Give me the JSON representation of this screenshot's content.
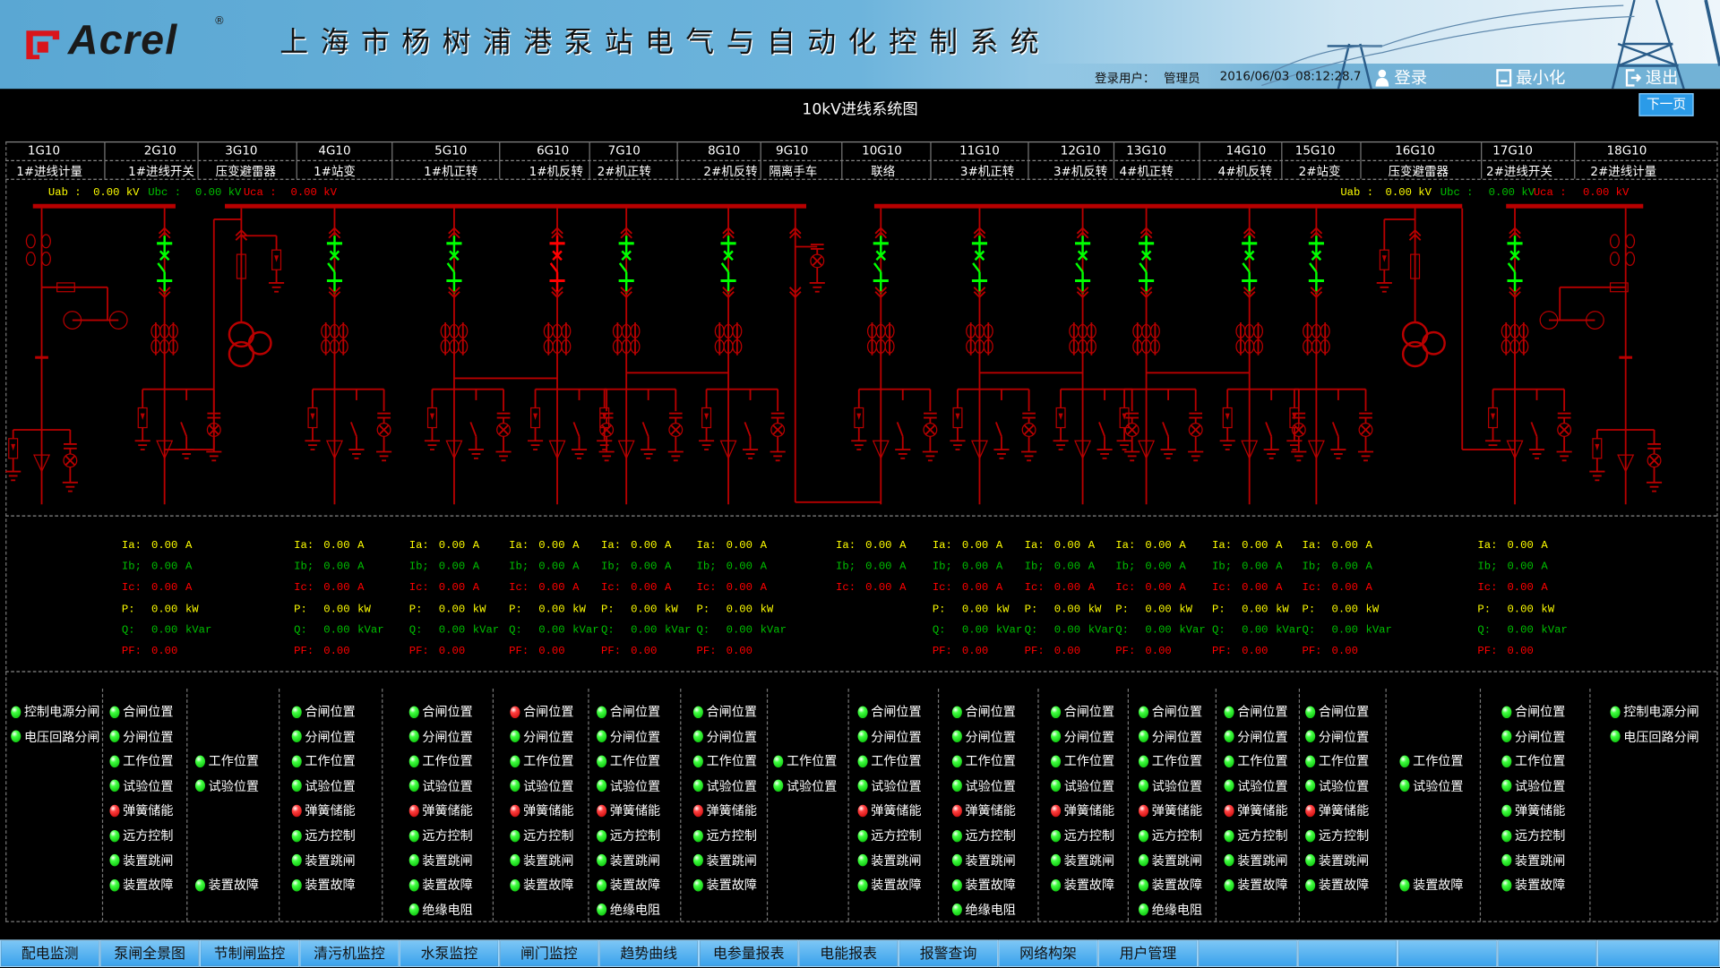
{
  "header": {
    "logo": "Acrel",
    "title": "上海市杨树浦港泵站电气与自动化控制系统",
    "login_user_label": "登录用户：",
    "login_user": "管理员",
    "date": "2016/06/03",
    "time": "08:12:28.7",
    "login_button": "登录",
    "minimize_button": "最小化",
    "exit_button": "退出"
  },
  "page": {
    "title": "10kV进线系统图",
    "next_page": "下一页"
  },
  "colors": {
    "closed": "#ff0000",
    "open": "#00ff00",
    "bus": "#b80000",
    "phase_a": "#ffff00",
    "phase_b": "#00c000",
    "phase_c": "#ff0000"
  },
  "cabinets": [
    {
      "id": "1G10",
      "name": "1#进线计量"
    },
    {
      "id": "2G10",
      "name": "1#进线开关"
    },
    {
      "id": "3G10",
      "name": "压变避雷器"
    },
    {
      "id": "4G10",
      "name": "1#站变"
    },
    {
      "id": "5G10",
      "name": "1#机正转"
    },
    {
      "id": "6G10",
      "name": "1#机反转"
    },
    {
      "id": "7G10",
      "name": "2#机正转"
    },
    {
      "id": "8G10",
      "name": "2#机反转"
    },
    {
      "id": "9G10",
      "name": "隔离手车"
    },
    {
      "id": "10G10",
      "name": "联络"
    },
    {
      "id": "11G10",
      "name": "3#机正转"
    },
    {
      "id": "12G10",
      "name": "3#机反转"
    },
    {
      "id": "13G10",
      "name": "4#机正转"
    },
    {
      "id": "14G10",
      "name": "4#机反转"
    },
    {
      "id": "15G10",
      "name": "2#站变"
    },
    {
      "id": "16G10",
      "name": "压变避雷器"
    },
    {
      "id": "17G10",
      "name": "2#进线开关"
    },
    {
      "id": "18G10",
      "name": "2#进线计量"
    }
  ],
  "voltage": {
    "left": {
      "uab_label": "Uab :",
      "uab": "0.00 kV",
      "ubc_label": "Ubc :",
      "ubc": "0.00 kV",
      "uca_label": "Uca :",
      "uca": "0.00 kV"
    },
    "right": {
      "uab_label": "Uab :",
      "uab": "0.00 kV",
      "ubc_label": "Ubc :",
      "ubc": "0.00 kV",
      "uca_label": "Uca :",
      "uca": "0.00 kV"
    }
  },
  "breakers": [
    {
      "cabinet": "2G10",
      "state": "open"
    },
    {
      "cabinet": "4G10",
      "state": "open"
    },
    {
      "cabinet": "5G10",
      "state": "open"
    },
    {
      "cabinet": "6G10",
      "state": "closed"
    },
    {
      "cabinet": "7G10",
      "state": "open"
    },
    {
      "cabinet": "8G10",
      "state": "open"
    },
    {
      "cabinet": "10G10",
      "state": "open"
    },
    {
      "cabinet": "11G10",
      "state": "open"
    },
    {
      "cabinet": "12G10",
      "state": "open"
    },
    {
      "cabinet": "13G10",
      "state": "open"
    },
    {
      "cabinet": "14G10",
      "state": "open"
    },
    {
      "cabinet": "15G10",
      "state": "open"
    },
    {
      "cabinet": "17G10",
      "state": "open"
    }
  ],
  "measurements": [
    {
      "cabinet": "2G10",
      "rows": [
        [
          "Ia:",
          "0.00",
          "A"
        ],
        [
          "Ib;",
          "0.00",
          "A"
        ],
        [
          "Ic:",
          "0.00",
          "A"
        ],
        [
          "P:",
          "0.00",
          "kW"
        ],
        [
          "Q:",
          "0.00",
          "kVar"
        ],
        [
          "PF:",
          "0.00",
          ""
        ]
      ]
    },
    {
      "cabinet": "4G10",
      "rows": [
        [
          "Ia:",
          "0.00",
          "A"
        ],
        [
          "Ib;",
          "0.00",
          "A"
        ],
        [
          "Ic:",
          "0.00",
          "A"
        ],
        [
          "P:",
          "0.00",
          "kW"
        ],
        [
          "Q:",
          "0.00",
          "kVar"
        ],
        [
          "PF:",
          "0.00",
          ""
        ]
      ]
    },
    {
      "cabinet": "5G10",
      "rows": [
        [
          "Ia:",
          "0.00",
          "A"
        ],
        [
          "Ib;",
          "0.00",
          "A"
        ],
        [
          "Ic:",
          "0.00",
          "A"
        ],
        [
          "P:",
          "0.00",
          "kW"
        ],
        [
          "Q:",
          "0.00",
          "kVar"
        ],
        [
          "PF:",
          "0.00",
          ""
        ]
      ]
    },
    {
      "cabinet": "6G10",
      "rows": [
        [
          "Ia:",
          "0.00",
          "A"
        ],
        [
          "Ib;",
          "0.00",
          "A"
        ],
        [
          "Ic:",
          "0.00",
          "A"
        ],
        [
          "P:",
          "0.00",
          "kW"
        ],
        [
          "Q:",
          "0.00",
          "kVar"
        ],
        [
          "PF:",
          "0.00",
          ""
        ]
      ]
    },
    {
      "cabinet": "7G10",
      "rows": [
        [
          "Ia:",
          "0.00",
          "A"
        ],
        [
          "Ib;",
          "0.00",
          "A"
        ],
        [
          "Ic:",
          "0.00",
          "A"
        ],
        [
          "P:",
          "0.00",
          "kW"
        ],
        [
          "Q:",
          "0.00",
          "kVar"
        ],
        [
          "PF:",
          "0.00",
          ""
        ]
      ]
    },
    {
      "cabinet": "8G10",
      "rows": [
        [
          "Ia:",
          "0.00",
          "A"
        ],
        [
          "Ib;",
          "0.00",
          "A"
        ],
        [
          "Ic:",
          "0.00",
          "A"
        ],
        [
          "P:",
          "0.00",
          "kW"
        ],
        [
          "Q:",
          "0.00",
          "kVar"
        ],
        [
          "PF:",
          "0.00",
          ""
        ]
      ]
    },
    {
      "cabinet": "10G10",
      "rows": [
        [
          "Ia:",
          "0.00",
          "A"
        ],
        [
          "Ib;",
          "0.00",
          "A"
        ],
        [
          "Ic:",
          "0.00",
          "A"
        ]
      ]
    },
    {
      "cabinet": "11G10",
      "rows": [
        [
          "Ia:",
          "0.00",
          "A"
        ],
        [
          "Ib;",
          "0.00",
          "A"
        ],
        [
          "Ic:",
          "0.00",
          "A"
        ],
        [
          "P:",
          "0.00",
          "kW"
        ],
        [
          "Q:",
          "0.00",
          "kVar"
        ],
        [
          "PF:",
          "0.00",
          ""
        ]
      ]
    },
    {
      "cabinet": "12G10",
      "rows": [
        [
          "Ia:",
          "0.00",
          "A"
        ],
        [
          "Ib;",
          "0.00",
          "A"
        ],
        [
          "Ic:",
          "0.00",
          "A"
        ],
        [
          "P:",
          "0.00",
          "kW"
        ],
        [
          "Q:",
          "0.00",
          "kVar"
        ],
        [
          "PF:",
          "0.00",
          ""
        ]
      ]
    },
    {
      "cabinet": "13G10",
      "rows": [
        [
          "Ia:",
          "0.00",
          "A"
        ],
        [
          "Ib;",
          "0.00",
          "A"
        ],
        [
          "Ic:",
          "0.00",
          "A"
        ],
        [
          "P:",
          "0.00",
          "kW"
        ],
        [
          "Q:",
          "0.00",
          "kVar"
        ],
        [
          "PF:",
          "0.00",
          ""
        ]
      ]
    },
    {
      "cabinet": "14G10",
      "rows": [
        [
          "Ia:",
          "0.00",
          "A"
        ],
        [
          "Ib;",
          "0.00",
          "A"
        ],
        [
          "Ic:",
          "0.00",
          "A"
        ],
        [
          "P:",
          "0.00",
          "kW"
        ],
        [
          "Q:",
          "0.00",
          "kVar"
        ],
        [
          "PF:",
          "0.00",
          ""
        ]
      ]
    },
    {
      "cabinet": "15G10",
      "rows": [
        [
          "Ia:",
          "0.00",
          "A"
        ],
        [
          "Ib;",
          "0.00",
          "A"
        ],
        [
          "Ic:",
          "0.00",
          "A"
        ],
        [
          "P:",
          "0.00",
          "kW"
        ],
        [
          "Q:",
          "0.00",
          "kVar"
        ],
        [
          "PF:",
          "0.00",
          ""
        ]
      ]
    },
    {
      "cabinet": "17G10",
      "rows": [
        [
          "Ia:",
          "0.00",
          "A"
        ],
        [
          "Ib;",
          "0.00",
          "A"
        ],
        [
          "Ic:",
          "0.00",
          "A"
        ],
        [
          "P:",
          "0.00",
          "kW"
        ],
        [
          "Q:",
          "0.00",
          "kVar"
        ],
        [
          "PF:",
          "0.00",
          ""
        ]
      ]
    }
  ],
  "status": [
    {
      "cabinet": "1G10",
      "items": [
        [
          "控制电源分闸",
          "green"
        ],
        [
          "电压回路分闸",
          "green"
        ]
      ]
    },
    {
      "cabinet": "2G10",
      "items": [
        [
          "合闸位置",
          "green"
        ],
        [
          "分闸位置",
          "green"
        ],
        [
          "工作位置",
          "green"
        ],
        [
          "试验位置",
          "green"
        ],
        [
          "弹簧储能",
          "red"
        ],
        [
          "远方控制",
          "green"
        ],
        [
          "装置跳闸",
          "green"
        ],
        [
          "装置故障",
          "green"
        ]
      ]
    },
    {
      "cabinet": "3G10",
      "items": [
        null,
        null,
        [
          "工作位置",
          "green"
        ],
        [
          "试验位置",
          "green"
        ],
        null,
        null,
        null,
        [
          "装置故障",
          "green"
        ]
      ]
    },
    {
      "cabinet": "4G10",
      "items": [
        [
          "合闸位置",
          "green"
        ],
        [
          "分闸位置",
          "green"
        ],
        [
          "工作位置",
          "green"
        ],
        [
          "试验位置",
          "green"
        ],
        [
          "弹簧储能",
          "red"
        ],
        [
          "远方控制",
          "green"
        ],
        [
          "装置跳闸",
          "green"
        ],
        [
          "装置故障",
          "green"
        ]
      ]
    },
    {
      "cabinet": "5G10",
      "items": [
        [
          "合闸位置",
          "green"
        ],
        [
          "分闸位置",
          "green"
        ],
        [
          "工作位置",
          "green"
        ],
        [
          "试验位置",
          "green"
        ],
        [
          "弹簧储能",
          "red"
        ],
        [
          "远方控制",
          "green"
        ],
        [
          "装置跳闸",
          "green"
        ],
        [
          "装置故障",
          "green"
        ],
        [
          "绝缘电阻",
          "green"
        ]
      ]
    },
    {
      "cabinet": "6G10",
      "items": [
        [
          "合闸位置",
          "red"
        ],
        [
          "分闸位置",
          "green"
        ],
        [
          "工作位置",
          "green"
        ],
        [
          "试验位置",
          "green"
        ],
        [
          "弹簧储能",
          "red"
        ],
        [
          "远方控制",
          "green"
        ],
        [
          "装置跳闸",
          "green"
        ],
        [
          "装置故障",
          "green"
        ]
      ]
    },
    {
      "cabinet": "7G10",
      "items": [
        [
          "合闸位置",
          "green"
        ],
        [
          "分闸位置",
          "green"
        ],
        [
          "工作位置",
          "green"
        ],
        [
          "试验位置",
          "green"
        ],
        [
          "弹簧储能",
          "red"
        ],
        [
          "远方控制",
          "green"
        ],
        [
          "装置跳闸",
          "green"
        ],
        [
          "装置故障",
          "green"
        ],
        [
          "绝缘电阻",
          "green"
        ]
      ]
    },
    {
      "cabinet": "8G10",
      "items": [
        [
          "合闸位置",
          "green"
        ],
        [
          "分闸位置",
          "green"
        ],
        [
          "工作位置",
          "green"
        ],
        [
          "试验位置",
          "green"
        ],
        [
          "弹簧储能",
          "red"
        ],
        [
          "远方控制",
          "green"
        ],
        [
          "装置跳闸",
          "green"
        ],
        [
          "装置故障",
          "green"
        ]
      ]
    },
    {
      "cabinet": "9G10",
      "items": [
        null,
        null,
        [
          "工作位置",
          "green"
        ],
        [
          "试验位置",
          "green"
        ]
      ]
    },
    {
      "cabinet": "10G10",
      "items": [
        [
          "合闸位置",
          "green"
        ],
        [
          "分闸位置",
          "green"
        ],
        [
          "工作位置",
          "green"
        ],
        [
          "试验位置",
          "green"
        ],
        [
          "弹簧储能",
          "red"
        ],
        [
          "远方控制",
          "green"
        ],
        [
          "装置跳闸",
          "green"
        ],
        [
          "装置故障",
          "green"
        ]
      ]
    },
    {
      "cabinet": "11G10",
      "items": [
        [
          "合闸位置",
          "green"
        ],
        [
          "分闸位置",
          "green"
        ],
        [
          "工作位置",
          "green"
        ],
        [
          "试验位置",
          "green"
        ],
        [
          "弹簧储能",
          "red"
        ],
        [
          "远方控制",
          "green"
        ],
        [
          "装置跳闸",
          "green"
        ],
        [
          "装置故障",
          "green"
        ],
        [
          "绝缘电阻",
          "green"
        ]
      ]
    },
    {
      "cabinet": "12G10",
      "items": [
        [
          "合闸位置",
          "green"
        ],
        [
          "分闸位置",
          "green"
        ],
        [
          "工作位置",
          "green"
        ],
        [
          "试验位置",
          "green"
        ],
        [
          "弹簧储能",
          "red"
        ],
        [
          "远方控制",
          "green"
        ],
        [
          "装置跳闸",
          "green"
        ],
        [
          "装置故障",
          "green"
        ]
      ]
    },
    {
      "cabinet": "13G10",
      "items": [
        [
          "合闸位置",
          "green"
        ],
        [
          "分闸位置",
          "green"
        ],
        [
          "工作位置",
          "green"
        ],
        [
          "试验位置",
          "green"
        ],
        [
          "弹簧储能",
          "red"
        ],
        [
          "远方控制",
          "green"
        ],
        [
          "装置跳闸",
          "green"
        ],
        [
          "装置故障",
          "green"
        ],
        [
          "绝缘电阻",
          "green"
        ]
      ]
    },
    {
      "cabinet": "14G10",
      "items": [
        [
          "合闸位置",
          "green"
        ],
        [
          "分闸位置",
          "green"
        ],
        [
          "工作位置",
          "green"
        ],
        [
          "试验位置",
          "green"
        ],
        [
          "弹簧储能",
          "red"
        ],
        [
          "远方控制",
          "green"
        ],
        [
          "装置跳闸",
          "green"
        ],
        [
          "装置故障",
          "green"
        ]
      ]
    },
    {
      "cabinet": "15G10",
      "items": [
        [
          "合闸位置",
          "green"
        ],
        [
          "分闸位置",
          "green"
        ],
        [
          "工作位置",
          "green"
        ],
        [
          "试验位置",
          "green"
        ],
        [
          "弹簧储能",
          "red"
        ],
        [
          "远方控制",
          "green"
        ],
        [
          "装置跳闸",
          "green"
        ],
        [
          "装置故障",
          "green"
        ]
      ]
    },
    {
      "cabinet": "16G10",
      "items": [
        null,
        null,
        [
          "工作位置",
          "green"
        ],
        [
          "试验位置",
          "green"
        ],
        null,
        null,
        null,
        [
          "装置故障",
          "green"
        ]
      ]
    },
    {
      "cabinet": "17G10",
      "items": [
        [
          "合闸位置",
          "green"
        ],
        [
          "分闸位置",
          "green"
        ],
        [
          "工作位置",
          "green"
        ],
        [
          "试验位置",
          "green"
        ],
        [
          "弹簧储能",
          "green"
        ],
        [
          "远方控制",
          "green"
        ],
        [
          "装置跳闸",
          "green"
        ],
        [
          "装置故障",
          "green"
        ]
      ]
    },
    {
      "cabinet": "18G10",
      "items": [
        [
          "控制电源分闸",
          "green"
        ],
        [
          "电压回路分闸",
          "green"
        ]
      ]
    }
  ],
  "nav": [
    "配电监测",
    "泵闸全景图",
    "节制闸监控",
    "清污机监控",
    "水泵监控",
    "闸门监控",
    "趋势曲线",
    "电参量报表",
    "电能报表",
    "报警查询",
    "网络构架",
    "用户管理",
    "",
    "",
    "",
    "",
    ""
  ]
}
